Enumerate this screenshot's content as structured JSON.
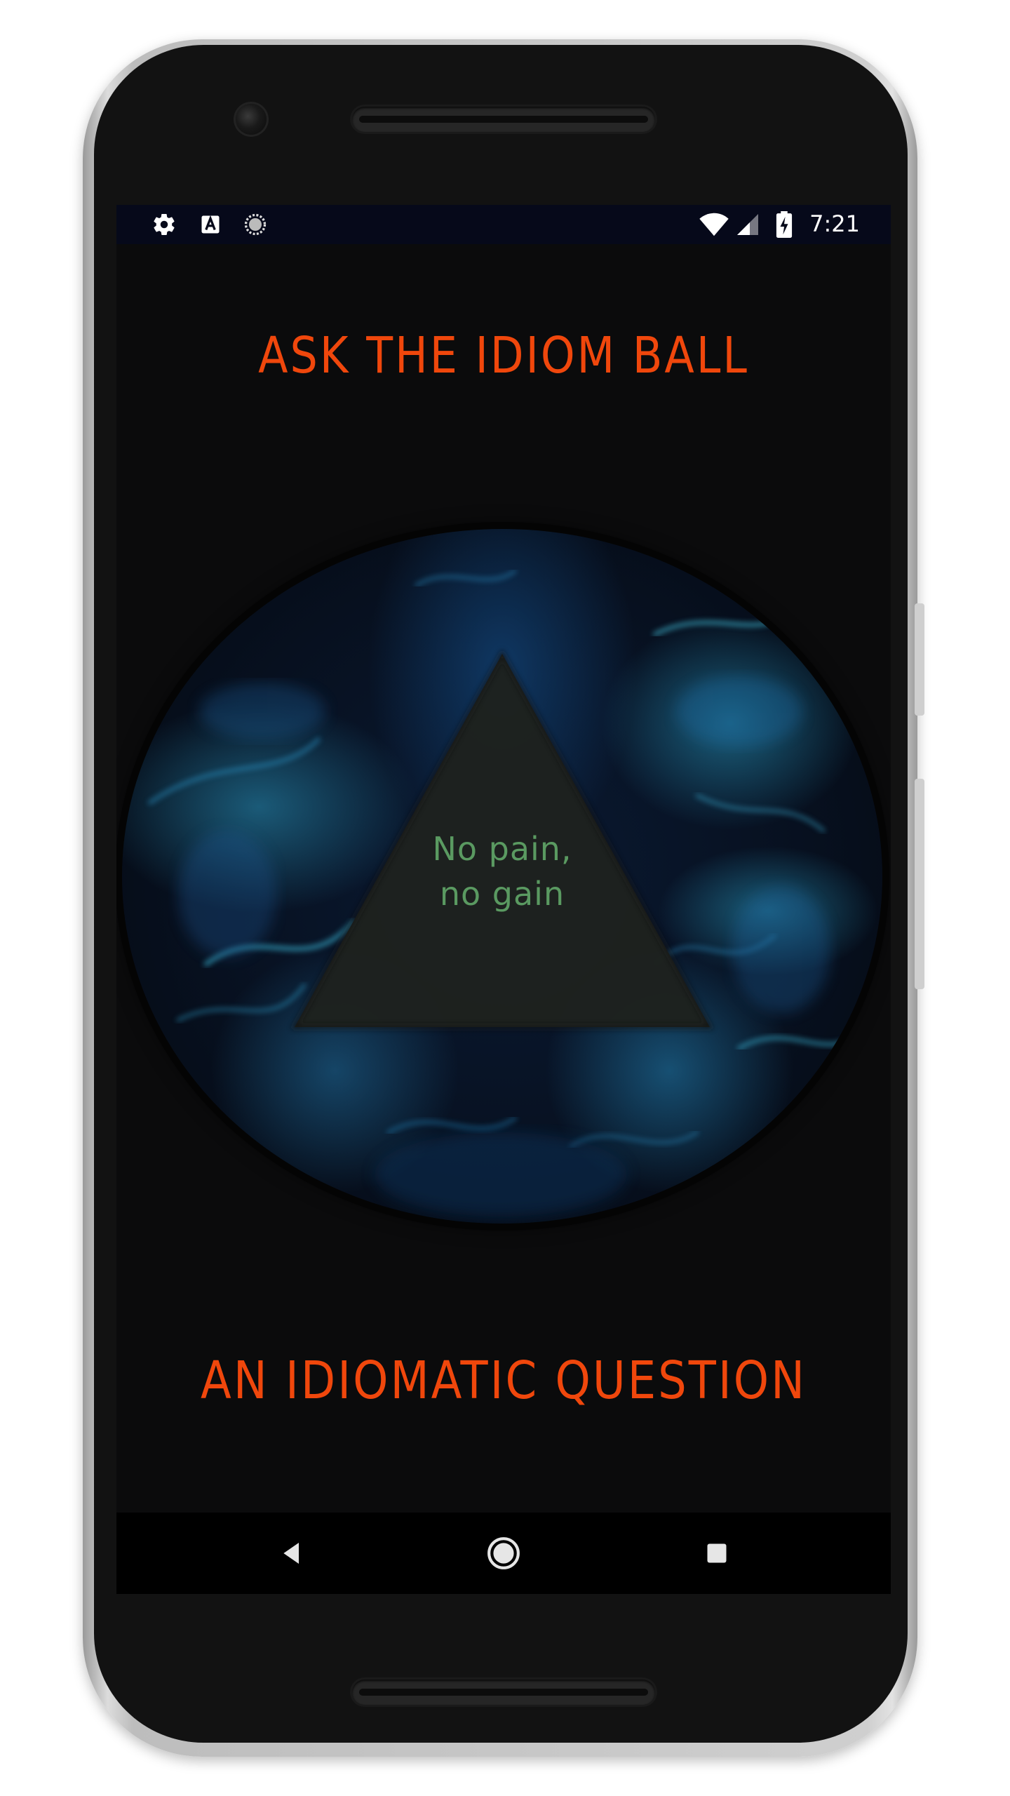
{
  "status_bar": {
    "time": "7:21",
    "left_icons": [
      "settings-icon",
      "text-a-icon",
      "sync-circle-icon"
    ],
    "right_icons": [
      "wifi-icon",
      "cell-signal-icon",
      "battery-charging-icon"
    ]
  },
  "app": {
    "title": "ASK THE IDIOM BALL",
    "ball": {
      "answer_line1": "No pain,",
      "answer_line2": "no gain"
    },
    "question_button": "AN IDIOMATIC QUESTION"
  },
  "navigation_bar": {
    "buttons": [
      "back-icon",
      "home-icon",
      "recents-icon"
    ]
  },
  "colors": {
    "accent": "#f0470c",
    "answer_text": "#5a9a61",
    "background": "#0b0b0c",
    "status_bar": "#06091a"
  }
}
